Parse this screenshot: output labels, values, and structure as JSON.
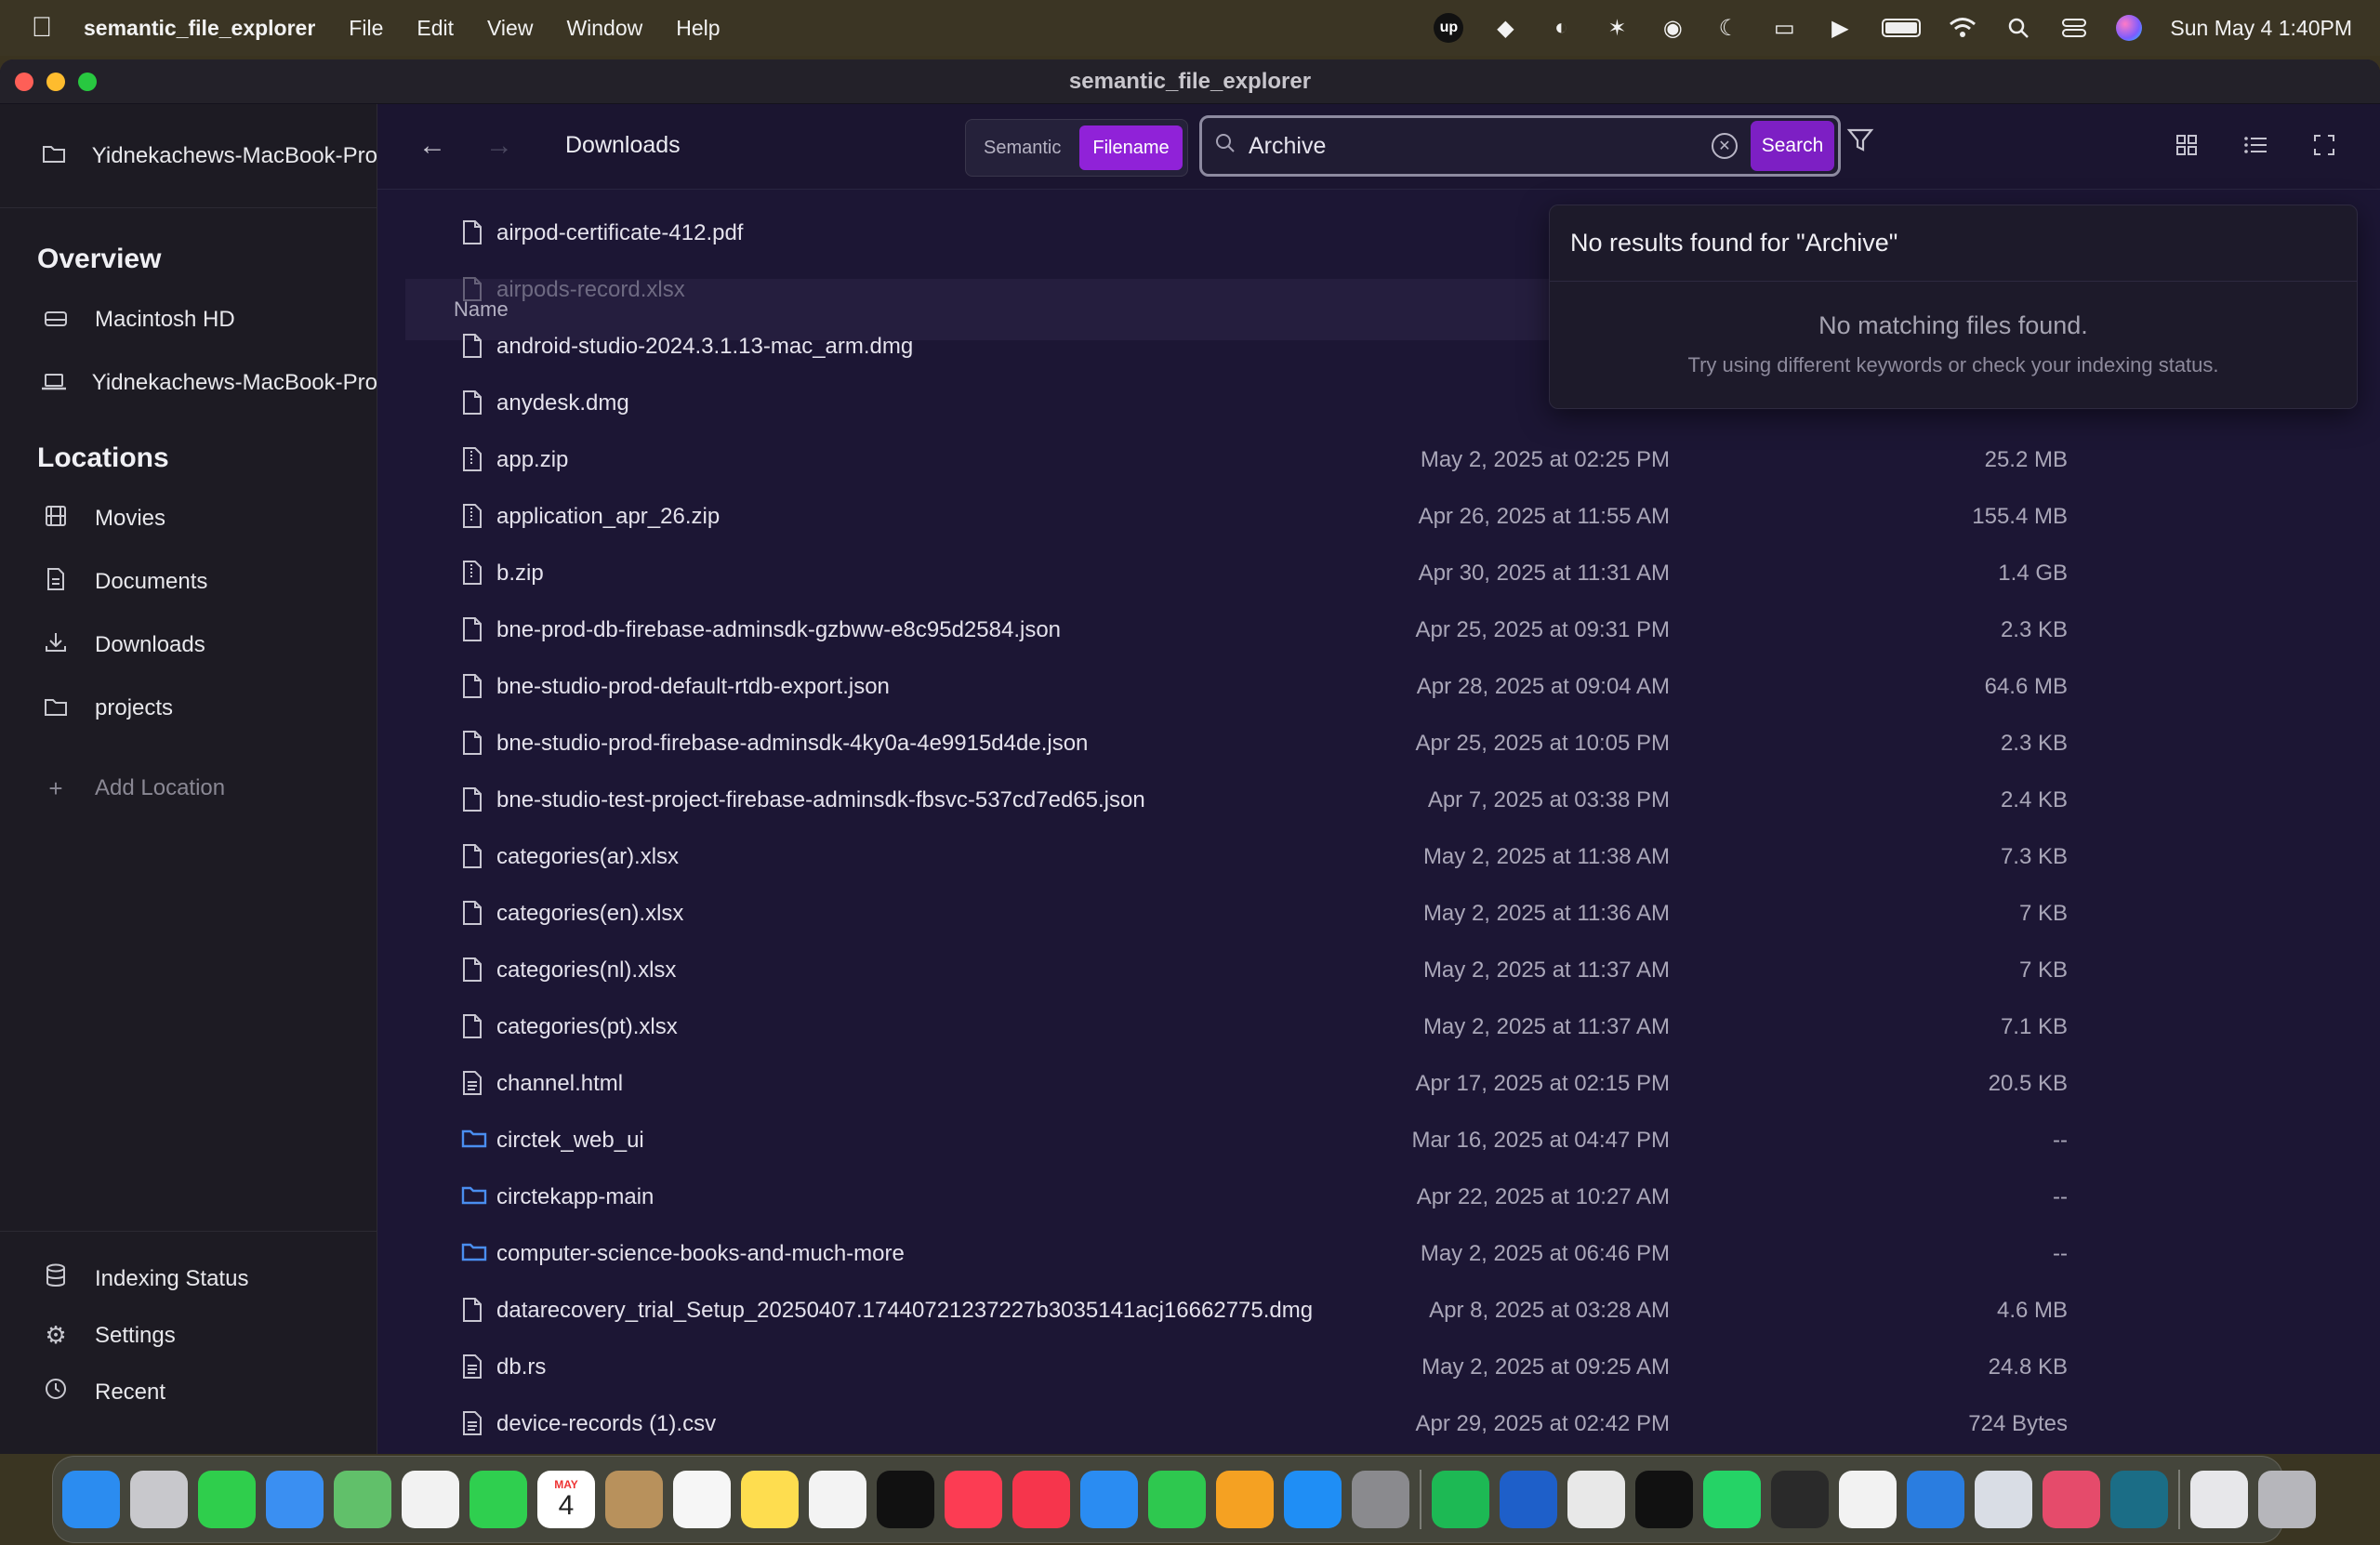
{
  "menubar": {
    "app_name": "semantic_file_explorer",
    "items": [
      "File",
      "Edit",
      "View",
      "Window",
      "Help"
    ],
    "clock": "Sun May 4  1:40PM",
    "tray_up": "up"
  },
  "window": {
    "title": "semantic_file_explorer"
  },
  "sidebar": {
    "host": "Yidnekachews-MacBook-Pro",
    "overview_heading": "Overview",
    "overview_items": [
      {
        "label": "Macintosh HD",
        "icon": "drive-icon"
      },
      {
        "label": "Yidnekachews-MacBook-Pro",
        "icon": "laptop-icon"
      }
    ],
    "locations_heading": "Locations",
    "location_items": [
      {
        "label": "Movies",
        "icon": "film-icon"
      },
      {
        "label": "Documents",
        "icon": "document-icon"
      },
      {
        "label": "Downloads",
        "icon": "download-icon"
      },
      {
        "label": "projects",
        "icon": "folder-icon"
      }
    ],
    "add_location": "Add Location",
    "bottom_items": [
      {
        "label": "Indexing Status",
        "icon": "database-icon"
      },
      {
        "label": "Settings",
        "icon": "gear-icon"
      },
      {
        "label": "Recent",
        "icon": "clock-icon"
      }
    ]
  },
  "toolbar": {
    "breadcrumb": "Downloads",
    "mode_semantic": "Semantic",
    "mode_filename": "Filename",
    "active_mode": "Filename",
    "search_value": "Archive",
    "search_button": "Search"
  },
  "list": {
    "name_header": "Name",
    "files": [
      {
        "name": "airpod-certificate-412.pdf",
        "date": "",
        "size": "",
        "kind": "file"
      },
      {
        "name": "airpods-record.xlsx",
        "date": "",
        "size": "",
        "kind": "file"
      },
      {
        "name": "android-studio-2024.3.1.13-mac_arm.dmg",
        "date": "",
        "size": "",
        "kind": "file"
      },
      {
        "name": "anydesk.dmg",
        "date": "",
        "size": "",
        "kind": "file"
      },
      {
        "name": "app.zip",
        "date": "May 2, 2025 at 02:25 PM",
        "size": "25.2 MB",
        "kind": "zip"
      },
      {
        "name": "application_apr_26.zip",
        "date": "Apr 26, 2025 at 11:55 AM",
        "size": "155.4 MB",
        "kind": "zip"
      },
      {
        "name": "b.zip",
        "date": "Apr 30, 2025 at 11:31 AM",
        "size": "1.4 GB",
        "kind": "zip"
      },
      {
        "name": "bne-prod-db-firebase-adminsdk-gzbww-e8c95d2584.json",
        "date": "Apr 25, 2025 at 09:31 PM",
        "size": "2.3 KB",
        "kind": "file"
      },
      {
        "name": "bne-studio-prod-default-rtdb-export.json",
        "date": "Apr 28, 2025 at 09:04 AM",
        "size": "64.6 MB",
        "kind": "file"
      },
      {
        "name": "bne-studio-prod-firebase-adminsdk-4ky0a-4e9915d4de.json",
        "date": "Apr 25, 2025 at 10:05 PM",
        "size": "2.3 KB",
        "kind": "file"
      },
      {
        "name": "bne-studio-test-project-firebase-adminsdk-fbsvc-537cd7ed65.json",
        "date": "Apr 7, 2025 at 03:38 PM",
        "size": "2.4 KB",
        "kind": "file"
      },
      {
        "name": "categories(ar).xlsx",
        "date": "May 2, 2025 at 11:38 AM",
        "size": "7.3 KB",
        "kind": "file"
      },
      {
        "name": "categories(en).xlsx",
        "date": "May 2, 2025 at 11:36 AM",
        "size": "7 KB",
        "kind": "file"
      },
      {
        "name": "categories(nl).xlsx",
        "date": "May 2, 2025 at 11:37 AM",
        "size": "7 KB",
        "kind": "file"
      },
      {
        "name": "categories(pt).xlsx",
        "date": "May 2, 2025 at 11:37 AM",
        "size": "7.1 KB",
        "kind": "file"
      },
      {
        "name": "channel.html",
        "date": "Apr 17, 2025 at 02:15 PM",
        "size": "20.5 KB",
        "kind": "text"
      },
      {
        "name": "circtek_web_ui",
        "date": "Mar 16, 2025 at 04:47 PM",
        "size": "--",
        "kind": "folder"
      },
      {
        "name": "circtekapp-main",
        "date": "Apr 22, 2025 at 10:27 AM",
        "size": "--",
        "kind": "folder"
      },
      {
        "name": "computer-science-books-and-much-more",
        "date": "May 2, 2025 at 06:46 PM",
        "size": "--",
        "kind": "folder"
      },
      {
        "name": "datarecovery_trial_Setup_20250407.17440721237227b3035141acj16662775.dmg",
        "date": "Apr 8, 2025 at 03:28 AM",
        "size": "4.6 MB",
        "kind": "file"
      },
      {
        "name": "db.rs",
        "date": "May 2, 2025 at 09:25 AM",
        "size": "24.8 KB",
        "kind": "text"
      },
      {
        "name": "device-records (1).csv",
        "date": "Apr 29, 2025 at 02:42 PM",
        "size": "724 Bytes",
        "kind": "text"
      }
    ]
  },
  "popover": {
    "title": "No results found for \"Archive\"",
    "message": "No matching files found.",
    "hint": "Try using different keywords or check your indexing status."
  },
  "dock": {
    "calendar_month": "MAY",
    "calendar_day": "4",
    "apps": [
      {
        "name": "finder-icon",
        "color": "#2b8cf0"
      },
      {
        "name": "launchpad-icon",
        "color": "#c8c8cc"
      },
      {
        "name": "messages-icon",
        "color": "#2fce4c"
      },
      {
        "name": "mail-icon",
        "color": "#3a8ff2"
      },
      {
        "name": "maps-icon",
        "color": "#61c06a"
      },
      {
        "name": "photos-icon",
        "color": "#f2f2f2"
      },
      {
        "name": "facetime-icon",
        "color": "#2fcf4f"
      },
      {
        "name": "calendar-icon",
        "color": "#ffffff"
      },
      {
        "name": "contacts-icon",
        "color": "#b8915c"
      },
      {
        "name": "reminders-icon",
        "color": "#f6f6f6"
      },
      {
        "name": "notes-icon",
        "color": "#fedd4f"
      },
      {
        "name": "freeform-icon",
        "color": "#f3f3f3"
      },
      {
        "name": "tv-icon",
        "color": "#111111"
      },
      {
        "name": "music-icon",
        "color": "#fc3c53"
      },
      {
        "name": "news-icon",
        "color": "#f6354c"
      },
      {
        "name": "keynote-icon",
        "color": "#2a8cf2"
      },
      {
        "name": "numbers-icon",
        "color": "#2ec84f"
      },
      {
        "name": "pages-icon",
        "color": "#f5a122"
      },
      {
        "name": "app-store-icon",
        "color": "#1f8ef5"
      },
      {
        "name": "system-settings-icon",
        "color": "#8a8a8e"
      },
      {
        "name": "spotify-icon",
        "color": "#1db954"
      },
      {
        "name": "word-icon",
        "color": "#1e5fc9"
      },
      {
        "name": "chrome-icon",
        "color": "#e8e8e8"
      },
      {
        "name": "upwork-icon",
        "color": "#111111"
      },
      {
        "name": "whatsapp-icon",
        "color": "#25d366"
      },
      {
        "name": "cube-app-icon",
        "color": "#2a2a2a"
      },
      {
        "name": "wps-icon",
        "color": "#f2f2f2"
      },
      {
        "name": "xcode-icon",
        "color": "#2a7de0"
      },
      {
        "name": "preview-icon",
        "color": "#d9dde5"
      },
      {
        "name": "photo-booth-icon",
        "color": "#e54b6b"
      },
      {
        "name": "qoder-icon",
        "color": "#1b6d86"
      },
      {
        "name": "documents-stack-icon",
        "color": "#e7e7ea"
      },
      {
        "name": "trash-icon",
        "color": "#b6b6bb"
      }
    ]
  },
  "colors": {
    "accent": "#9022d8",
    "search_button": "#7d1fc4",
    "folder": "#4a8ef0"
  }
}
